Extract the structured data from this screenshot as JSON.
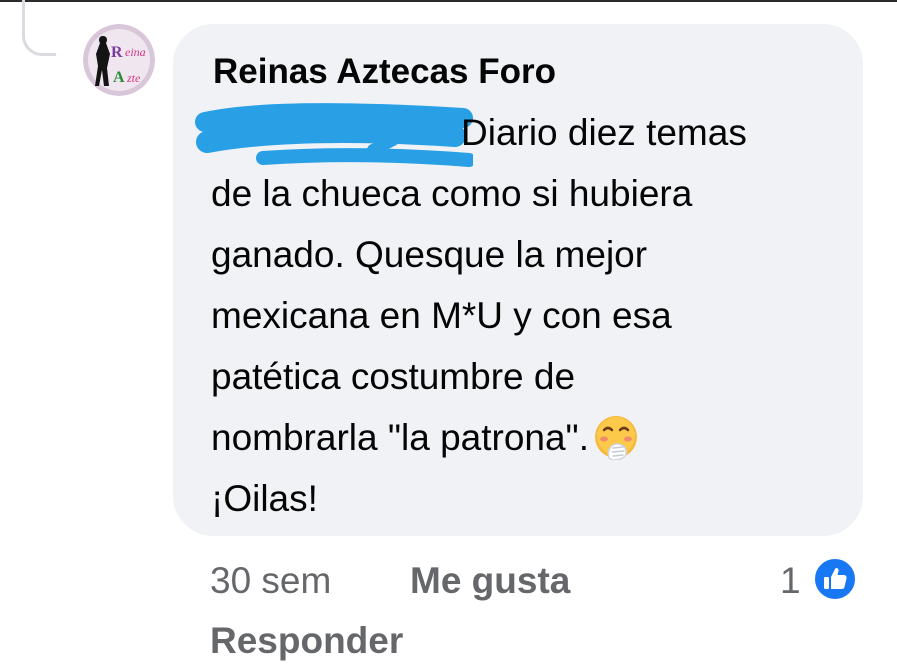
{
  "comment": {
    "author": "Reinas Aztecas Foro",
    "avatar_icon": "reinas-aztecas-logo",
    "mention_redacted": true,
    "text_lines": [
      "Diario diez temas",
      "de la chueca como si hubiera",
      "ganado. Quesque la mejor",
      "mexicana en M*U y con esa",
      "patética costumbre de",
      "nombrarla \"la patrona\".",
      "¡Oilas!"
    ],
    "emoji": "face-with-hand-over-mouth"
  },
  "actions": {
    "time": "30 sem",
    "like_label": "Me gusta",
    "reply_label": "Responder"
  },
  "reactions": {
    "count": "1",
    "icon": "like-thumb-icon"
  },
  "colors": {
    "bubble": "#f0f2f5",
    "text": "#050505",
    "meta": "#65676b",
    "like_blue": "#1877f2",
    "redaction_blue": "#29a0e6"
  }
}
